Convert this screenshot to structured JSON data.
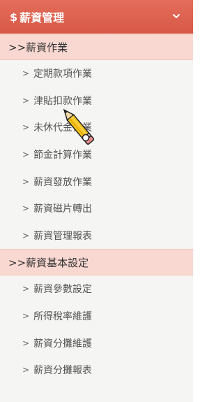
{
  "menu": {
    "header": {
      "symbol": "$",
      "title": "薪資管理"
    },
    "sections": [
      {
        "title": ">>薪資作業",
        "items": [
          {
            "label": "定期款項作業"
          },
          {
            "label": "津貼扣款作業"
          },
          {
            "label": "未休代金作業"
          },
          {
            "label": "節金計算作業"
          },
          {
            "label": "薪資發放作業"
          },
          {
            "label": "薪資磁片轉出"
          },
          {
            "label": "薪資管理報表"
          }
        ]
      },
      {
        "title": ">>薪資基本設定",
        "items": [
          {
            "label": "薪資參數設定"
          },
          {
            "label": "所得稅率維護"
          },
          {
            "label": "薪資分攤維護"
          },
          {
            "label": "薪資分攤報表"
          }
        ]
      }
    ],
    "caret": ">"
  },
  "colors": {
    "header_bg": "#d85846",
    "section_bg": "#f9d8d2",
    "panel_bg": "#f5f5f3"
  },
  "cursor": {
    "type": "pencil-cursor"
  }
}
